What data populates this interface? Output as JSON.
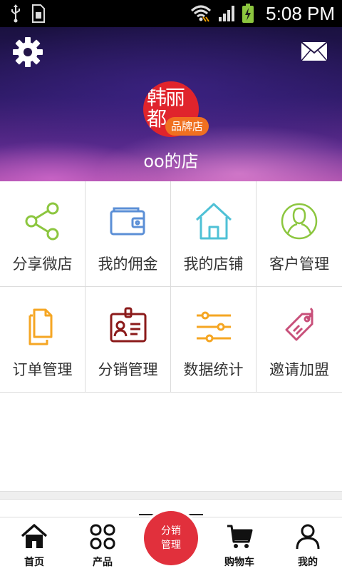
{
  "status_bar": {
    "time": "5:08 PM",
    "icons": [
      "usb-icon",
      "sim-icon",
      "wifi-icon",
      "signal-icon",
      "battery-icon"
    ]
  },
  "header": {
    "settings_icon": "gear-icon",
    "message_icon": "mail-icon",
    "avatar_text": "韩丽都",
    "brand_tag": "品牌店",
    "shop_name": "oo的店"
  },
  "menu": {
    "items": [
      {
        "label": "分享微店",
        "icon": "share-icon",
        "color": "#8cc63f"
      },
      {
        "label": "我的佣金",
        "icon": "wallet-icon",
        "color": "#5b8fd6"
      },
      {
        "label": "我的店铺",
        "icon": "home-icon",
        "color": "#4fc1d6"
      },
      {
        "label": "客户管理",
        "icon": "user-icon",
        "color": "#8cc63f"
      },
      {
        "label": "订单管理",
        "icon": "documents-icon",
        "color": "#f5a623"
      },
      {
        "label": "分销管理",
        "icon": "id-card-icon",
        "color": "#8b1a1a"
      },
      {
        "label": "数据统计",
        "icon": "sliders-icon",
        "color": "#f5a623"
      },
      {
        "label": "邀请加盟",
        "icon": "tag-icon",
        "color": "#c8507a"
      }
    ]
  },
  "bottom_nav": {
    "items": [
      {
        "label": "首页",
        "icon": "home-icon"
      },
      {
        "label": "产品",
        "icon": "grid-icon"
      },
      {
        "label": "购物车",
        "icon": "cart-icon"
      },
      {
        "label": "我的",
        "icon": "person-icon"
      }
    ],
    "center_line1": "分销",
    "center_line2": "管理",
    "center_color": "#e1303c"
  }
}
